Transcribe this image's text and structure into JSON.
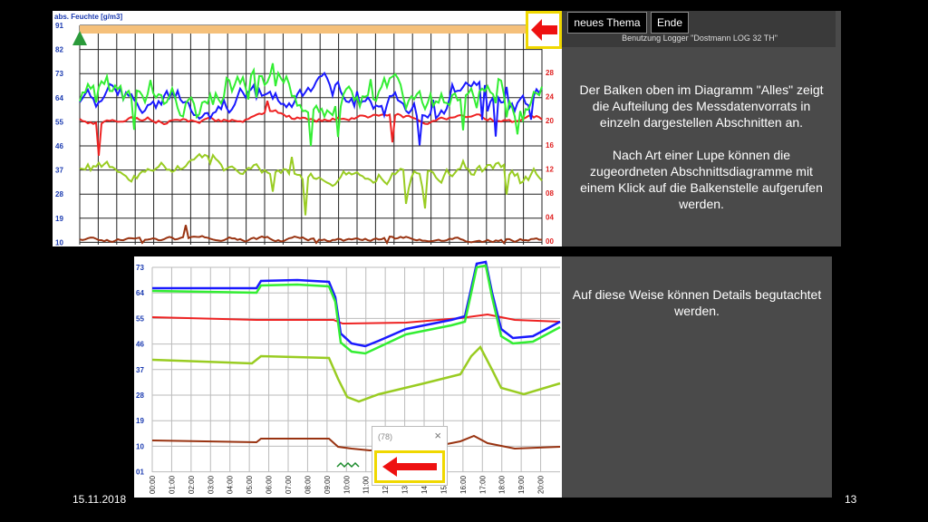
{
  "top_chart": {
    "title_fragment": "abs. Feuchte [g/m3]",
    "left_ticks": [
      "91",
      "82",
      "73",
      "64",
      "55",
      "46",
      "37",
      "28",
      "19",
      "10"
    ],
    "right_ticks": [
      "28",
      "24",
      "20",
      "16",
      "12",
      "08",
      "04",
      "00"
    ]
  },
  "bottom_chart": {
    "left_ticks": [
      "73",
      "64",
      "55",
      "46",
      "37",
      "28",
      "19",
      "10",
      "01"
    ],
    "time_ticks": [
      "00:00",
      "01:00",
      "02:00",
      "03:00",
      "04:00",
      "05:00",
      "06:00",
      "07:00",
      "08:00",
      "09:00",
      "10:00",
      "11:00",
      "12:00",
      "13:00",
      "14:00",
      "15:00",
      "16:00",
      "17:00",
      "18:00",
      "19:00",
      "20:00"
    ]
  },
  "panel_top": {
    "new_topic_label": "neues Thema",
    "end_label": "Ende",
    "logger_label": "Benutzung Logger \"Dostmann LOG 32 TH\"",
    "text_1": "Der Balken oben im Diagramm \"Alles\" zeigt die Aufteilung des Messdatenvorrats in einzeln dargestellen Abschnitten an.",
    "text_2": "Nach Art einer Lupe können die zugeordneten Abschnittsdiagramme mit einem Klick auf die Balkenstelle aufgerufen werden."
  },
  "panel_bottom": {
    "text": "Auf diese Weise können Details begutachtet werden."
  },
  "popup": {
    "title": "(78)",
    "close": "×"
  },
  "footer": {
    "date": "15.11.2018",
    "page": "13"
  },
  "colors": {
    "blue": "#1a1aff",
    "green": "#33ee33",
    "red": "#ee2222",
    "olive": "#99cc22",
    "brown": "#993311",
    "bar": "#f5c07a"
  }
}
